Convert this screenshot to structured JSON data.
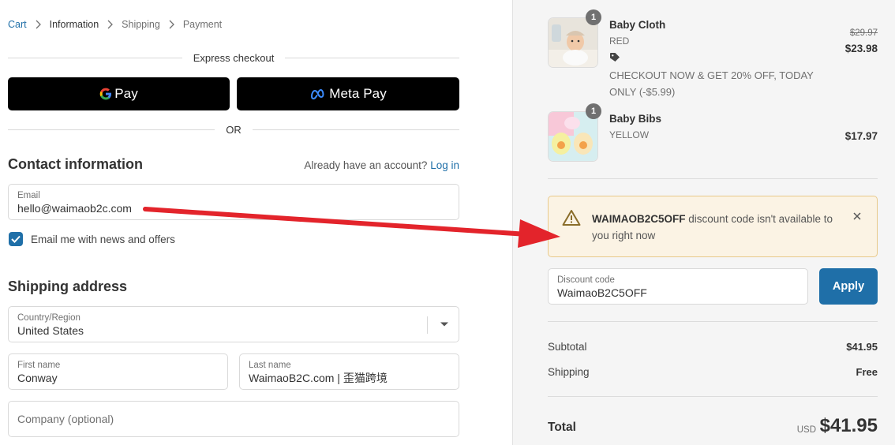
{
  "breadcrumb": {
    "cart": "Cart",
    "information": "Information",
    "shipping": "Shipping",
    "payment": "Payment"
  },
  "express": {
    "title": "Express checkout",
    "gpay_label": "Pay",
    "metapay_label": "Meta Pay",
    "or_label": "OR"
  },
  "contact": {
    "title": "Contact information",
    "login_prompt": "Already have an account?",
    "login_link": "Log in",
    "email_label": "Email",
    "email_value": "hello@waimaob2c.com",
    "newsletter_label": "Email me with news and offers",
    "newsletter_checked": true
  },
  "shipping_address": {
    "title": "Shipping address",
    "country_label": "Country/Region",
    "country_value": "United States",
    "first_name_label": "First name",
    "first_name_value": "Conway",
    "last_name_label": "Last name",
    "last_name_value": "WaimaoB2C.com | 歪猫跨境",
    "company_placeholder": "Company (optional)"
  },
  "order": {
    "items": [
      {
        "name": "Baby Cloth",
        "variant": "RED",
        "quantity": "1",
        "original_price": "$29.97",
        "price": "$23.98",
        "discount_note": "CHECKOUT NOW & GET 20% OFF, TODAY ONLY (-$5.99)"
      },
      {
        "name": "Baby Bibs",
        "variant": "YELLOW",
        "quantity": "1",
        "price": "$17.97"
      }
    ],
    "alert": {
      "code": "WAIMAOB2C5OFF",
      "message": "discount code isn't available to you right now"
    },
    "discount_label": "Discount code",
    "discount_value": "WaimaoB2C5OFF",
    "apply_label": "Apply",
    "subtotal_label": "Subtotal",
    "subtotal_value": "$41.95",
    "shipping_label": "Shipping",
    "shipping_value": "Free",
    "total_label": "Total",
    "total_currency": "USD",
    "total_value": "$41.95"
  },
  "colors": {
    "accent": "#1f6fa8",
    "alert_bg": "#fbf3e4",
    "alert_border": "#e8c98a",
    "arrow": "#e3242b",
    "sidebar_bg": "#f5f5f5"
  },
  "icons": [
    "chevron-right-icon",
    "google-g-icon",
    "meta-icon",
    "check-icon",
    "chevron-down-icon",
    "tag-icon",
    "warning-icon",
    "close-icon",
    "annotation-arrow"
  ]
}
